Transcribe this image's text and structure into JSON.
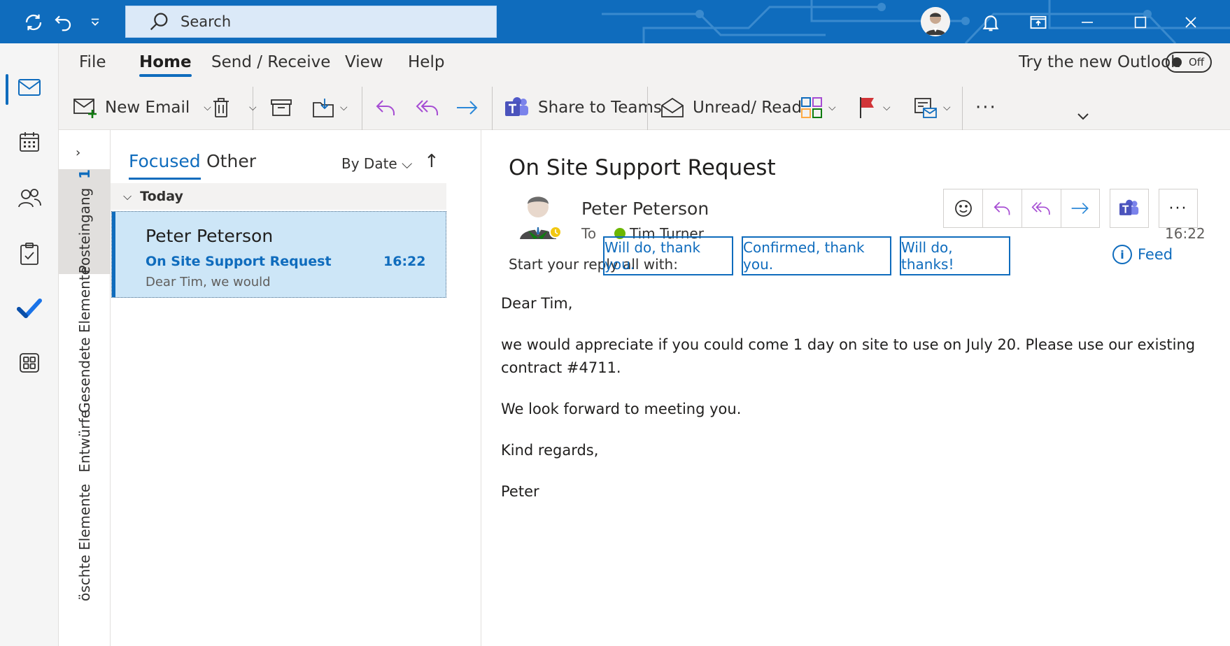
{
  "titlebar": {
    "search_placeholder": "Search",
    "icons": [
      "sync-icon",
      "undo-icon",
      "quick-access-dropdown-icon",
      "search-icon",
      "user-avatar",
      "bell-icon",
      "restore-window-icon",
      "minimize-icon",
      "maximize-icon",
      "close-icon"
    ]
  },
  "apprail": {
    "items": [
      "mail-icon",
      "calendar-icon",
      "people-icon",
      "tasks-icon",
      "todo-check-icon",
      "apps-icon"
    ]
  },
  "ribbon": {
    "tabs": [
      "File",
      "Home",
      "Send / Receive",
      "View",
      "Help"
    ],
    "active_tab": "Home",
    "try_new": "Try the new Outlook",
    "toggle": "Off",
    "new_email": "New Email",
    "share_to_teams": "Share to Teams",
    "unread_read": "Unread/ Read",
    "more": "···",
    "colors": {
      "accent": "#0f6cbd",
      "reply_purple": "#a64dd3",
      "forward_blue": "#2b88d8",
      "flag_red": "#d13438",
      "teams_purple": "#5059c9"
    }
  },
  "folders": {
    "inbox": "Posteingang",
    "inbox_count": "1",
    "sent": "Gesendete Elemente",
    "drafts": "Entwürfe",
    "deleted": "öschte Elemente"
  },
  "list": {
    "tab_focused": "Focused",
    "tab_other": "Other",
    "sort": "By Date",
    "sort_direction": "↑",
    "group": "Today",
    "item": {
      "from": "Peter Peterson",
      "subject": "On Site Support Request",
      "time": "16:22",
      "preview": "Dear Tim,  we would"
    }
  },
  "reading": {
    "subject": "On Site Support Request",
    "sender": "Peter Peterson",
    "to_label": "To",
    "recipient": "Tim Turner",
    "time": "16:22",
    "reply_prompt": "Start your reply all with:",
    "suggestions": [
      "Will do, thank you.",
      "Confirmed, thank you.",
      "Will do, thanks!"
    ],
    "feed": "Feed",
    "body": [
      "Dear Tim,",
      "we would appreciate if you could come 1 day on site to use on July 20. Please use our existing contract #4711.",
      "We look forward to meeting you.",
      "Kind regards,",
      "Peter"
    ]
  }
}
